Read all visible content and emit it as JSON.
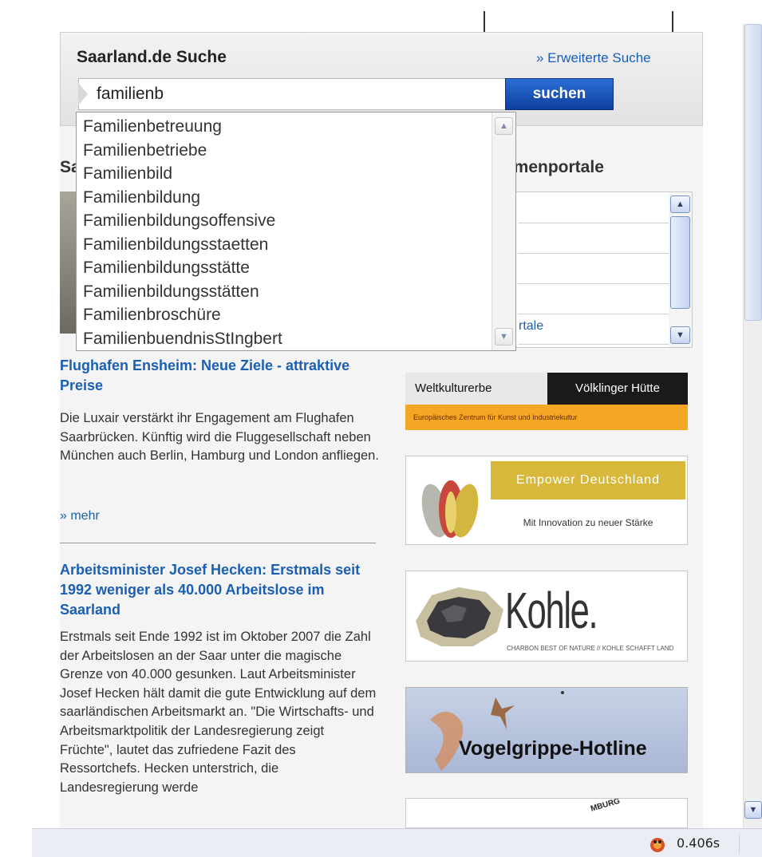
{
  "search": {
    "title": "Saarland.de Suche",
    "advanced_link": "» Erweiterte Suche",
    "query": "familienb",
    "button_label": "suchen"
  },
  "suggestions": [
    "Familienbetreuung",
    "Familienbetriebe",
    "Familienbild",
    "Familienbildung",
    "Familienbildungsoffensive",
    "Familienbildungsstaetten",
    "Familienbildungsstätte",
    "Familienbildungsstätten",
    "Familienbroschüre",
    "FamilienbuendnisStIngbert"
  ],
  "left_heading_visible": "Sa",
  "portal": {
    "heading_visible": "emenportale",
    "link_visible": "rtale"
  },
  "news": [
    {
      "title": "Flughafen Ensheim: Neue Ziele - attraktive Preise",
      "text": "Die Luxair verstärkt ihr Engagement am Flughafen Saarbrücken. Künftig wird die Fluggesellschaft neben München auch Berlin, Hamburg und London anfliegen.",
      "more": "» mehr"
    },
    {
      "title": "Arbeitsminister Josef Hecken: Erstmals seit 1992 weniger als 40.000 Arbeitslose im Saarland",
      "text": "Erstmals seit Ende 1992 ist im Oktober 2007 die Zahl der Arbeitslosen an der Saar unter die magische Grenze von 40.000 gesunken. Laut Arbeitsminister Josef Hecken hält damit die gute Entwicklung auf dem saarländischen Arbeitsmarkt an. \"Die Wirtschafts- und Arbeitsmarktpolitik der Landesregierung zeigt Früchte\", lautet das zufriedene Fazit des Ressortchefs. Hecken unterstrich, die Landesregierung werde"
    }
  ],
  "banners": {
    "welt_left": "Weltkulturerbe",
    "welt_right": "Völklinger Hütte",
    "welt_bottom": "Europäisches Zentrum für Kunst und Industriekultur",
    "empower_title": "Empower Deutschland",
    "empower_sub": "Mit Innovation zu neuer Stärke",
    "kohle_title": "Kohle.",
    "kohle_sub": "CHARBON  BEST OF NATURE // KOHLE SCHAFFT LAND",
    "vogel_title": "Vogelgrippe-Hotline",
    "burg_text": "MBURG"
  },
  "status": {
    "time": "0.406s"
  },
  "colors": {
    "link": "#1a5fb4",
    "search_button": "#0d3f9e",
    "welt_orange": "#f5a623",
    "empower_gold": "#d7b83a"
  }
}
